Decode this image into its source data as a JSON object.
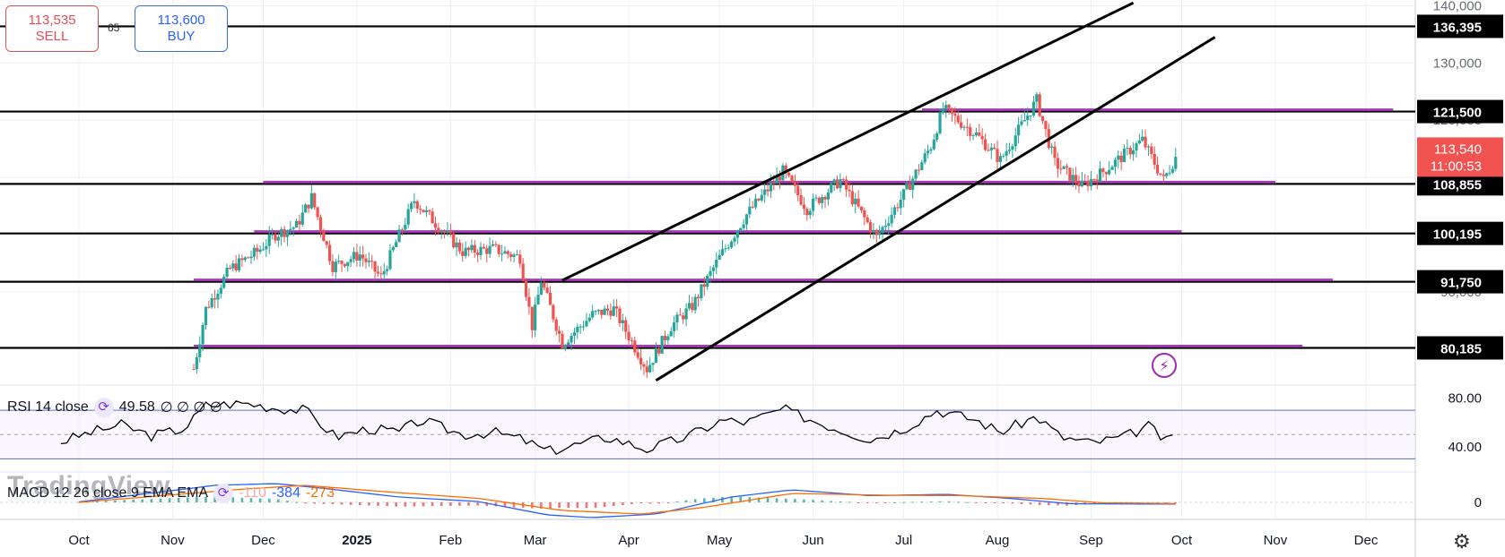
{
  "trade": {
    "sell_price": "113,535",
    "sell_label": "SELL",
    "buy_price": "113,600",
    "buy_label": "BUY",
    "spread": "65"
  },
  "watermark": "TradingView",
  "rsi": {
    "label": "RSI 14 close",
    "value": "49.58",
    "extras": "∅ ∅ ∅ ∅"
  },
  "macd": {
    "label": "MACD 12 26 close 9 EMA EMA",
    "v1": "-110",
    "v2": "-384",
    "v3": "-273"
  },
  "current_price": {
    "price": "113,540",
    "countdown": "11:00:53"
  },
  "icons": {
    "bolt": "lightning-icon",
    "settings": "gear-icon",
    "indicator": "cycle-icon"
  },
  "colors": {
    "up": "#26a69a",
    "down": "#ef5350",
    "zone": "#9c27b0",
    "level": "#000000",
    "rsi": "#000000",
    "macd": "#2962ff",
    "signal": "#ff6d00",
    "price_tag": "#f05350"
  },
  "chart_data": {
    "type": "candlestick",
    "y_axis_ticks": [
      "140,000",
      "130,000",
      "120,000",
      "110,000",
      "90,000"
    ],
    "ylim": [
      74000,
      141000
    ],
    "x_axis_labels": [
      "Oct",
      "Nov",
      "Dec",
      "2025",
      "Feb",
      "Mar",
      "Apr",
      "May",
      "Jun",
      "Jul",
      "Aug",
      "Sep",
      "Oct",
      "Nov",
      "Dec"
    ],
    "x_axis_dates": [
      "2024-10-01",
      "2024-11-01",
      "2024-12-01",
      "2025-01-01",
      "2025-02-01",
      "2025-03-01",
      "2025-04-01",
      "2025-05-01",
      "2025-06-01",
      "2025-07-01",
      "2025-08-01",
      "2025-09-01",
      "2025-10-01",
      "2025-11-01",
      "2025-12-01"
    ],
    "horizontal_levels": [
      {
        "label": "136,395",
        "price": 136395
      },
      {
        "label": "121,500",
        "price": 121500
      },
      {
        "label": "108,855",
        "price": 108855
      },
      {
        "label": "100,195",
        "price": 100195
      },
      {
        "label": "91,750",
        "price": 91750
      },
      {
        "label": "80,185",
        "price": 80185
      }
    ],
    "trendlines": [
      {
        "from": [
          "2025-03-10",
          92000
        ],
        "to": [
          "2025-09-15",
          140500
        ]
      },
      {
        "from": [
          "2025-04-10",
          74500
        ],
        "to": [
          "2025-10-12",
          134500
        ]
      }
    ],
    "price_path": [
      [
        "2024-11-08",
        76500
      ],
      [
        "2024-11-12",
        87000
      ],
      [
        "2024-11-20",
        94000
      ],
      [
        "2024-11-29",
        97000
      ],
      [
        "2024-12-05",
        100000
      ],
      [
        "2024-12-12",
        101500
      ],
      [
        "2024-12-17",
        106500
      ],
      [
        "2024-12-24",
        94500
      ],
      [
        "2025-01-02",
        96500
      ],
      [
        "2025-01-09",
        92500
      ],
      [
        "2025-01-20",
        106000
      ],
      [
        "2025-01-27",
        102000
      ],
      [
        "2025-02-05",
        97000
      ],
      [
        "2025-02-15",
        97500
      ],
      [
        "2025-02-24",
        96000
      ],
      [
        "2025-02-28",
        84000
      ],
      [
        "2025-03-03",
        92000
      ],
      [
        "2025-03-10",
        81000
      ],
      [
        "2025-03-20",
        86000
      ],
      [
        "2025-03-27",
        87000
      ],
      [
        "2025-04-07",
        76500
      ],
      [
        "2025-04-15",
        84000
      ],
      [
        "2025-04-22",
        87500
      ],
      [
        "2025-05-01",
        96000
      ],
      [
        "2025-05-10",
        103500
      ],
      [
        "2025-05-22",
        111000
      ],
      [
        "2025-05-30",
        104500
      ],
      [
        "2025-06-10",
        109500
      ],
      [
        "2025-06-22",
        99500
      ],
      [
        "2025-07-01",
        107000
      ],
      [
        "2025-07-10",
        115500
      ],
      [
        "2025-07-14",
        122000
      ],
      [
        "2025-07-25",
        117500
      ],
      [
        "2025-08-02",
        113000
      ],
      [
        "2025-08-14",
        123500
      ],
      [
        "2025-08-20",
        112500
      ],
      [
        "2025-08-29",
        108500
      ],
      [
        "2025-09-05",
        111000
      ],
      [
        "2025-09-18",
        116500
      ],
      [
        "2025-09-25",
        109500
      ],
      [
        "2025-09-29",
        113540
      ]
    ],
    "rsi_levels": [
      70,
      50,
      30
    ],
    "rsi_ticks": [
      "80.00",
      "40.00"
    ],
    "rsi_path": [
      [
        "2024-09-25",
        44
      ],
      [
        "2024-10-05",
        52
      ],
      [
        "2024-10-15",
        58
      ],
      [
        "2024-10-25",
        49
      ],
      [
        "2024-11-05",
        55
      ],
      [
        "2024-11-12",
        74
      ],
      [
        "2024-11-25",
        76
      ],
      [
        "2024-12-05",
        72
      ],
      [
        "2024-12-15",
        70
      ],
      [
        "2024-12-25",
        48
      ],
      [
        "2025-01-05",
        55
      ],
      [
        "2025-01-15",
        52
      ],
      [
        "2025-01-22",
        62
      ],
      [
        "2025-02-05",
        50
      ],
      [
        "2025-02-15",
        52
      ],
      [
        "2025-02-25",
        46
      ],
      [
        "2025-03-05",
        36
      ],
      [
        "2025-03-12",
        40
      ],
      [
        "2025-03-25",
        48
      ],
      [
        "2025-04-07",
        38
      ],
      [
        "2025-04-20",
        48
      ],
      [
        "2025-05-02",
        62
      ],
      [
        "2025-05-10",
        60
      ],
      [
        "2025-05-22",
        71
      ],
      [
        "2025-06-05",
        58
      ],
      [
        "2025-06-20",
        46
      ],
      [
        "2025-07-01",
        55
      ],
      [
        "2025-07-12",
        70
      ],
      [
        "2025-07-25",
        62
      ],
      [
        "2025-08-02",
        52
      ],
      [
        "2025-08-14",
        65
      ],
      [
        "2025-08-22",
        48
      ],
      [
        "2025-09-01",
        43
      ],
      [
        "2025-09-12",
        48
      ],
      [
        "2025-09-20",
        57
      ],
      [
        "2025-09-26",
        44
      ],
      [
        "2025-09-29",
        49.58
      ]
    ],
    "macd_zero_tick": "0",
    "macd_path": [
      [
        "2024-10-01",
        100
      ],
      [
        "2024-11-15",
        3800
      ],
      [
        "2024-12-05",
        4200
      ],
      [
        "2024-12-20",
        3200
      ],
      [
        "2025-01-15",
        1200
      ],
      [
        "2025-02-10",
        200
      ],
      [
        "2025-03-05",
        -2800
      ],
      [
        "2025-03-20",
        -3400
      ],
      [
        "2025-04-10",
        -2600
      ],
      [
        "2025-05-05",
        1200
      ],
      [
        "2025-05-25",
        2800
      ],
      [
        "2025-06-20",
        1500
      ],
      [
        "2025-07-15",
        1800
      ],
      [
        "2025-08-05",
        900
      ],
      [
        "2025-08-25",
        -300
      ],
      [
        "2025-09-29",
        -384
      ]
    ],
    "signal_path": [
      [
        "2024-10-01",
        0
      ],
      [
        "2024-11-25",
        3000
      ],
      [
        "2024-12-15",
        3800
      ],
      [
        "2025-01-10",
        2400
      ],
      [
        "2025-02-10",
        900
      ],
      [
        "2025-03-10",
        -1800
      ],
      [
        "2025-04-05",
        -2600
      ],
      [
        "2025-04-25",
        -1200
      ],
      [
        "2025-05-25",
        2000
      ],
      [
        "2025-06-25",
        1600
      ],
      [
        "2025-07-20",
        1500
      ],
      [
        "2025-08-15",
        900
      ],
      [
        "2025-09-05",
        -100
      ],
      [
        "2025-09-29",
        -273
      ]
    ]
  }
}
